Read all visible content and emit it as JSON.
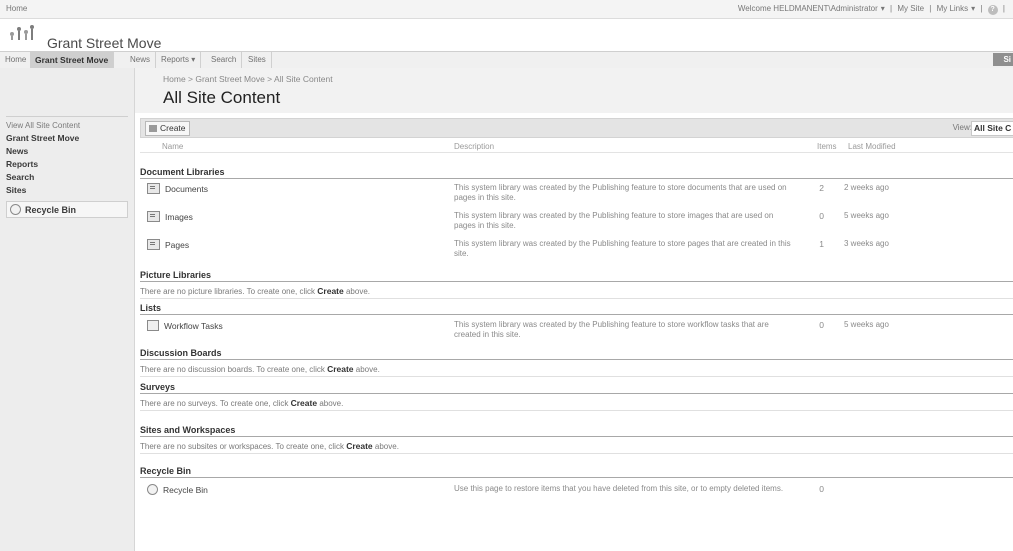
{
  "top": {
    "home_link": "Home",
    "welcome": "Welcome HELDMANENT\\Administrator",
    "my_site": "My Site",
    "my_links": "My Links",
    "help": "?"
  },
  "site": {
    "title": "Grant Street Move"
  },
  "nav": {
    "tabs": [
      "Home",
      "Grant Street Move",
      "News",
      "Reports",
      "Search",
      "Sites"
    ],
    "site_actions": "Si"
  },
  "page": {
    "breadcrumb": "Home > Grant Street Move > All Site Content",
    "title": "All Site Content"
  },
  "quick_launch": {
    "view_all": "View All Site Content",
    "items": [
      "Grant Street Move",
      "News",
      "Reports",
      "Search",
      "Sites"
    ],
    "recycle_bin": "Recycle Bin"
  },
  "toolbar": {
    "create": "Create",
    "view_label": "View:",
    "view_value": "All Site C"
  },
  "columns": {
    "name": "Name",
    "description": "Description",
    "items": "Items",
    "modified": "Last Modified"
  },
  "sections": {
    "document_libraries": "Document Libraries",
    "picture_libraries": "Picture Libraries",
    "lists": "Lists",
    "discussion_boards": "Discussion Boards",
    "surveys": "Surveys",
    "sites_workspaces": "Sites and Workspaces",
    "recycle_bin": "Recycle Bin"
  },
  "empty": {
    "picture": "There are no picture libraries. To create one, click",
    "discussion": "There are no discussion boards. To create one, click",
    "surveys": "There are no surveys. To create one, click",
    "sites": "There are no subsites or workspaces. To create one, click",
    "create_word": "Create",
    "above": "above."
  },
  "documents": [
    {
      "name": "Documents",
      "description": "This system library was created by the Publishing feature to store documents that are used on pages in this site.",
      "count": "2",
      "modified": "2 weeks ago"
    },
    {
      "name": "Images",
      "description": "This system library was created by the Publishing feature to store images that are used on pages in this site.",
      "count": "0",
      "modified": "5 weeks ago"
    },
    {
      "name": "Pages",
      "description": "This system library was created by the Publishing feature to store pages that are created in this site.",
      "count": "1",
      "modified": "3 weeks ago"
    }
  ],
  "lists": [
    {
      "name": "Workflow Tasks",
      "description": "This system library was created by the Publishing feature to store workflow tasks that are created in this site.",
      "count": "0",
      "modified": "5 weeks ago"
    }
  ],
  "recycle": {
    "name": "Recycle Bin",
    "description": "Use this page to restore items that you have deleted from this site, or to empty deleted items.",
    "count": "0"
  }
}
